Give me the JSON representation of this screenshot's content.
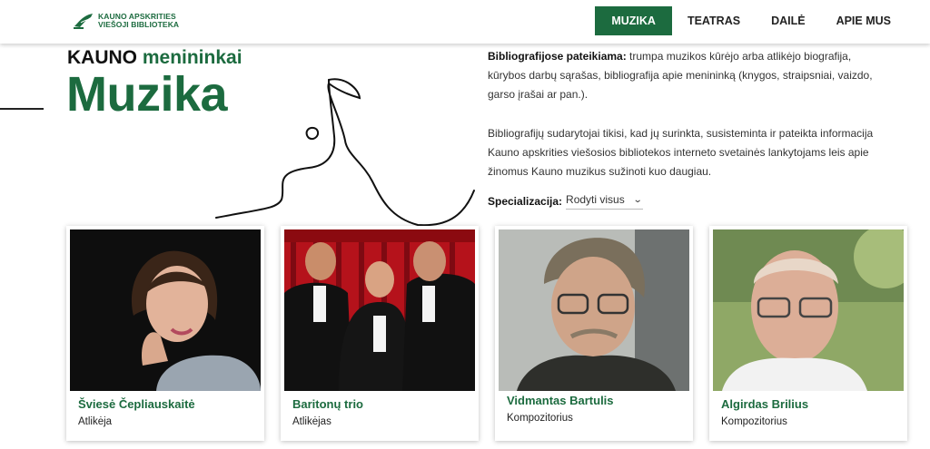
{
  "header": {
    "logo": {
      "line1": "KAUNO APSKRITIES",
      "line2": "VIEŠOJI BIBLIOTEKA"
    },
    "nav": [
      {
        "label": "MUZIKA",
        "active": true
      },
      {
        "label": "TEATRAS",
        "active": false
      },
      {
        "label": "DAILĖ",
        "active": false
      },
      {
        "label": "APIE MUS",
        "active": false
      }
    ]
  },
  "hero": {
    "prefix": "KAUNO",
    "subtitle": "menininkai",
    "title": "Muzika"
  },
  "description": {
    "p1_bold": "Bibliografijose pateikiama:",
    "p1_text": " trumpa muzikos kūrėjo arba atlikėjo biografija, kūrybos darbų sąrašas, bibliografija apie menininką (knygos, straipsniai, vaizdo, garso įrašai ar pan.).",
    "p2": "Bibliografijų sudarytojai tikisi, kad jų surinkta, susisteminta ir pateikta informacija Kauno apskrities viešosios bibliotekos interneto svetainės lankytojams leis apie žinomus Kauno muzikus sužinoti kuo daugiau."
  },
  "filter": {
    "label": "Specializacija:",
    "value": "Rodyti visus"
  },
  "cards": [
    {
      "name": "Šviesė Čepliauskaitė",
      "role": "Atlikėja"
    },
    {
      "name": "Baritonų trio",
      "role": "Atlikėjas"
    },
    {
      "name": "Vidmantas Bartulis",
      "role": "Kompozitorius"
    },
    {
      "name": "Algirdas Brilius",
      "role": "Kompozitorius"
    }
  ],
  "colors": {
    "brand_green": "#1c6b3f"
  }
}
